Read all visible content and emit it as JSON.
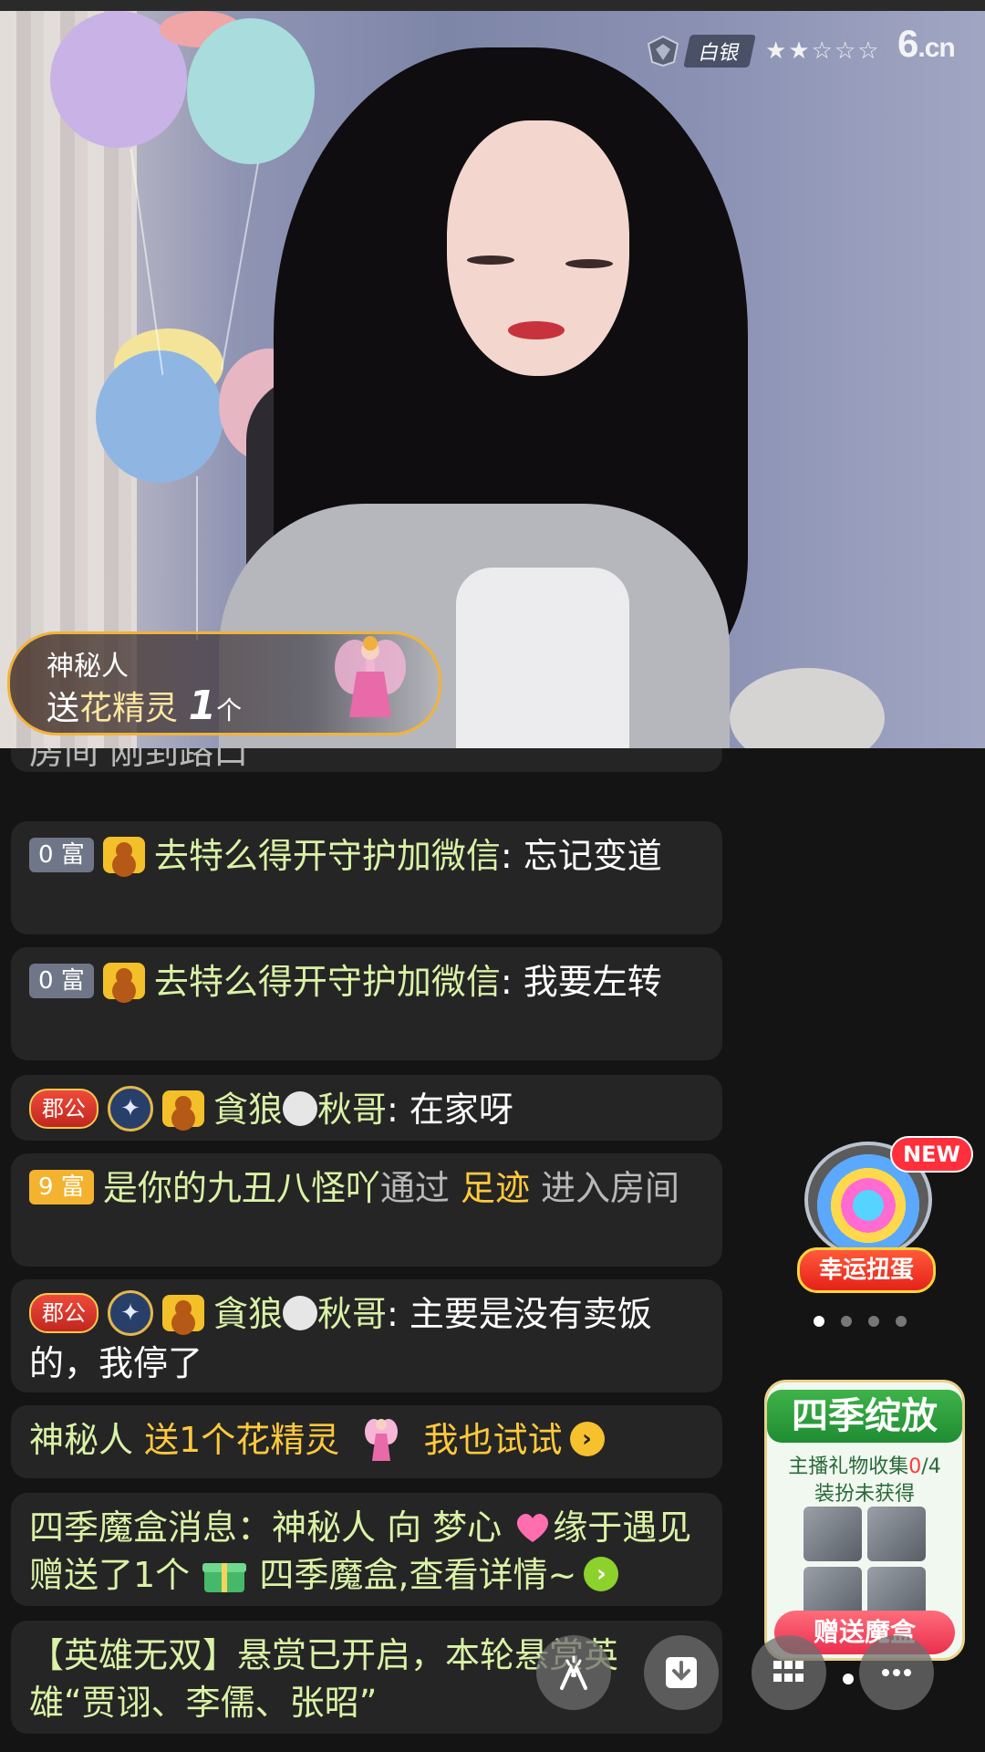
{
  "video": {
    "rank_label": "白银",
    "rank_stars": "★★☆☆☆",
    "site_logo": "6",
    "site_logo_suffix": ".cn",
    "gift_banner": {
      "sender": "神秘人",
      "prefix": "送",
      "gift_name": "花精灵",
      "count": "1",
      "unit": "个"
    }
  },
  "chat": {
    "partial_top": "房间 刚到路口",
    "messages": [
      {
        "rich_level": "0 富",
        "user": "去特么得开守护加微信",
        "text": ": 忘记变道"
      },
      {
        "rich_level": "0 富",
        "user": "去特么得开守护加微信",
        "text": ": 我要左转"
      },
      {
        "title_badge": "郡公",
        "user_a": "貪狼",
        "user_b": "秋哥",
        "text": ": 在家呀"
      },
      {
        "rich_level": "9 富",
        "user": "是你的九丑八怪吖",
        "via": "通过",
        "source": "足迹",
        "action": "进入房间"
      },
      {
        "title_badge": "郡公",
        "user_a": "貪狼",
        "user_b": "秋哥",
        "text": ": 主要是没有卖饭的，我停了"
      },
      {
        "user": "神秘人",
        "gift_text": "送1个花精灵",
        "try_label": "我也试试"
      },
      {
        "prefix": "四季魔盒消息：神秘人 向 梦心",
        "middle": "缘于遇见 赠送了1个",
        "suffix": "四季魔盒,查看详情~"
      },
      {
        "text": "【英雄无双】悬赏已开启，本轮悬赏英雄“贾诩、李儒、张昭”"
      }
    ]
  },
  "widgets": {
    "capsule": {
      "new_tag": "NEW",
      "label": "幸运扭蛋"
    },
    "season": {
      "title": "四季绽放",
      "collect_prefix": "主播礼物收集",
      "collect_have": "0",
      "collect_total": "/4",
      "status": "装扮未获得",
      "button": "赠送魔盒"
    }
  },
  "icons": [
    "rank-emblem-icon",
    "fairy-icon",
    "user-avatar-icon",
    "star-medal-icon",
    "wolf-icon",
    "chevron-right-icon",
    "heart-icon",
    "gift-box-icon",
    "hands-icon",
    "download-icon",
    "grid-icon",
    "more-icon"
  ],
  "colors": {
    "accent_gold": "#ffc93c",
    "username_green": "#d9f2a6",
    "banner_border": "#f2b33a"
  }
}
